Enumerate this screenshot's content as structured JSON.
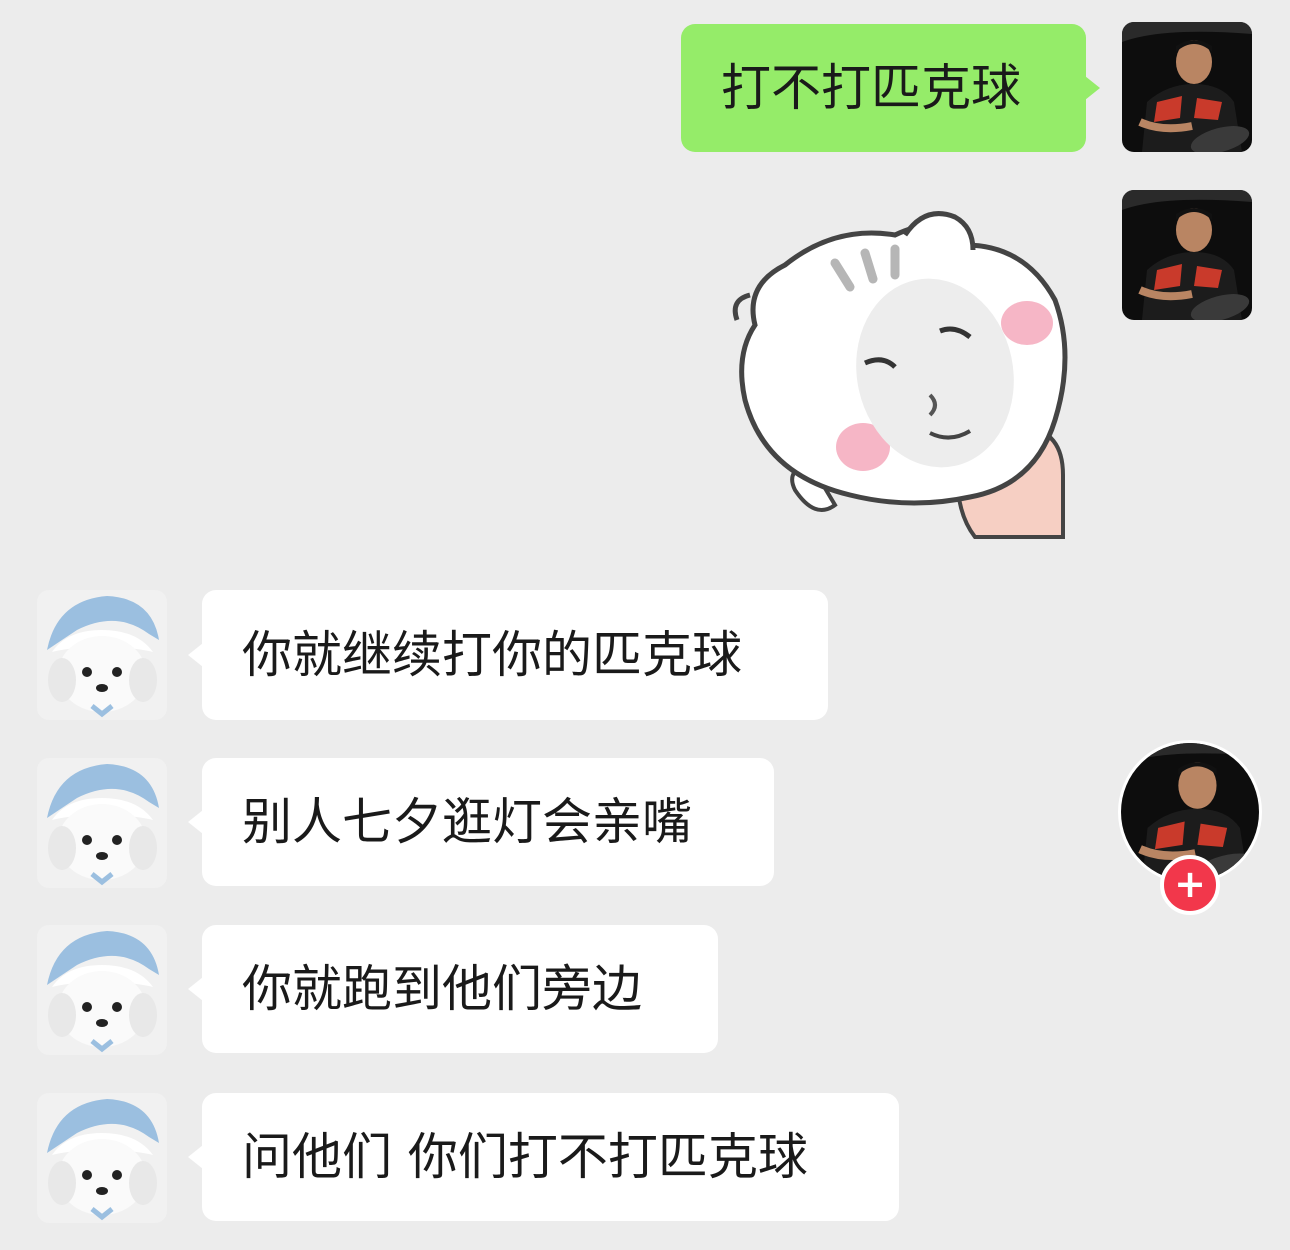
{
  "chat": {
    "messages": [
      {
        "side": "mine",
        "text": "打不打匹克球"
      },
      {
        "side": "mine",
        "sticker": "cat-face-sticker"
      },
      {
        "side": "theirs",
        "text": "你就继续打你的匹克球"
      },
      {
        "side": "theirs",
        "text": "别人七夕逛灯会亲嘴"
      },
      {
        "side": "theirs",
        "text": "你就跑到他们旁边"
      },
      {
        "side": "theirs",
        "text": "问他们 你们打不打匹克球"
      }
    ]
  },
  "follow": {
    "plus_label": "+"
  },
  "colors": {
    "background": "#ececec",
    "mine_bubble": "#95ec69",
    "theirs_bubble": "#ffffff",
    "follow_badge": "#f2374b"
  },
  "icons": {
    "my_avatar": "player-photo-avatar",
    "their_avatar": "plush-toy-avatar",
    "follow": "plus-icon"
  }
}
